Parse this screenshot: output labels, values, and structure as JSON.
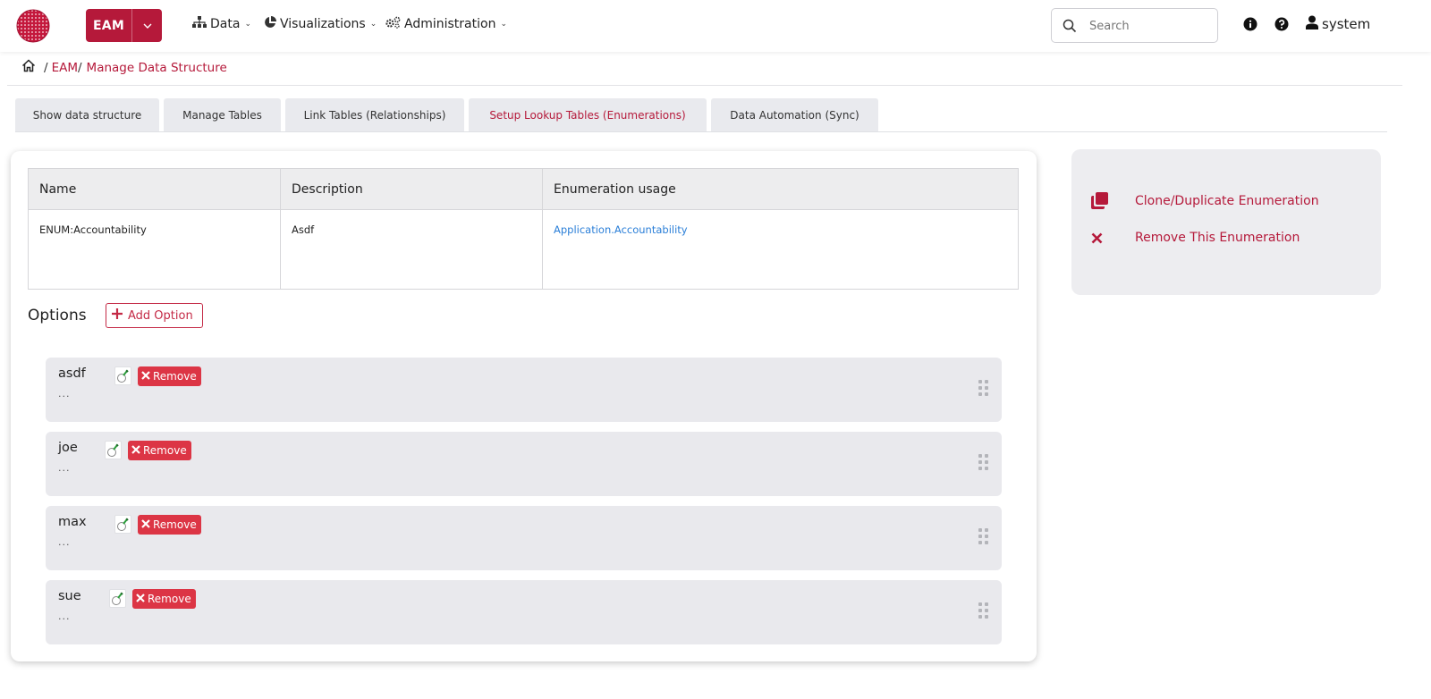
{
  "nav": {
    "app_label": "EAM",
    "menus": [
      {
        "label": "Data",
        "icon": "sitemap-icon"
      },
      {
        "label": "Visualizations",
        "icon": "chart-pie-icon"
      },
      {
        "label": "Administration",
        "icon": "cogs-icon"
      }
    ],
    "search_placeholder": "Search",
    "user_name": "system"
  },
  "breadcrumb": {
    "items": [
      "EAM",
      "Manage Data Structure"
    ]
  },
  "tabs": [
    {
      "label": "Show data structure",
      "active": false
    },
    {
      "label": "Manage Tables",
      "active": false
    },
    {
      "label": "Link Tables (Relationships)",
      "active": false
    },
    {
      "label": "Setup Lookup Tables (Enumerations)",
      "active": true
    },
    {
      "label": "Data Automation (Sync)",
      "active": false
    }
  ],
  "enumeration": {
    "headers": [
      "Name",
      "Description",
      "Enumeration usage"
    ],
    "row": {
      "name": "ENUM:Accountability",
      "description": "Asdf",
      "usage": "Application.Accountability"
    }
  },
  "options": {
    "title": "Options",
    "add_label": "Add Option",
    "remove_label": "Remove",
    "items": [
      {
        "name": "asdf",
        "description": "..."
      },
      {
        "name": "joe",
        "description": "..."
      },
      {
        "name": "max",
        "description": "..."
      },
      {
        "name": "sue",
        "description": "..."
      }
    ]
  },
  "actions": [
    {
      "label": "Clone/Duplicate Enumeration",
      "icon": "clone-icon"
    },
    {
      "label": "Remove This Enumeration",
      "icon": "times-icon"
    }
  ],
  "colors": {
    "brand": "#b5193a",
    "danger": "#dc3545",
    "link": "#2b7fd8"
  }
}
